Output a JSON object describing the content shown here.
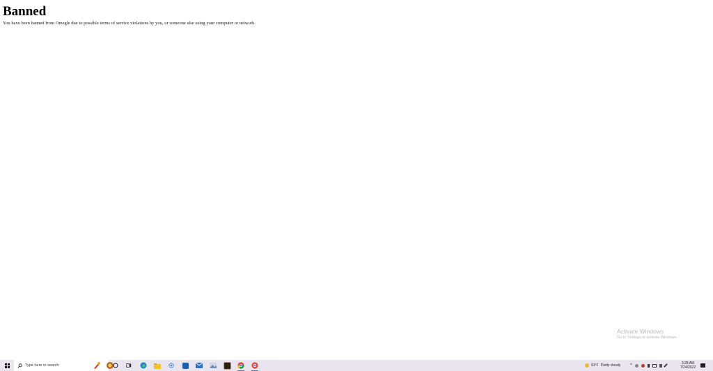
{
  "page": {
    "title": "Banned",
    "message": "You have been banned from Omegle due to possible terms of service violations by you, or someone else using your computer or network."
  },
  "watermark": {
    "line1": "Activate Windows",
    "line2": "Go to Settings to activate Windows."
  },
  "taskbar": {
    "search_placeholder": "Type here to search",
    "apps": [
      "cortana-icon",
      "task-view-icon",
      "edge-icon",
      "file-explorer-icon",
      "settings-icon",
      "store-icon",
      "mail-icon",
      "photos-icon",
      "terminal-icon",
      "chrome-icon",
      "chrome-app-icon"
    ],
    "weather": {
      "temp": "91°F",
      "condition": "Partly cloudy"
    },
    "clock": {
      "time": "3:28 AM",
      "date": "7/24/2022"
    },
    "colors": {
      "taskbar_bg": "#e9e5ee",
      "accent": "#3b7bd4"
    }
  }
}
